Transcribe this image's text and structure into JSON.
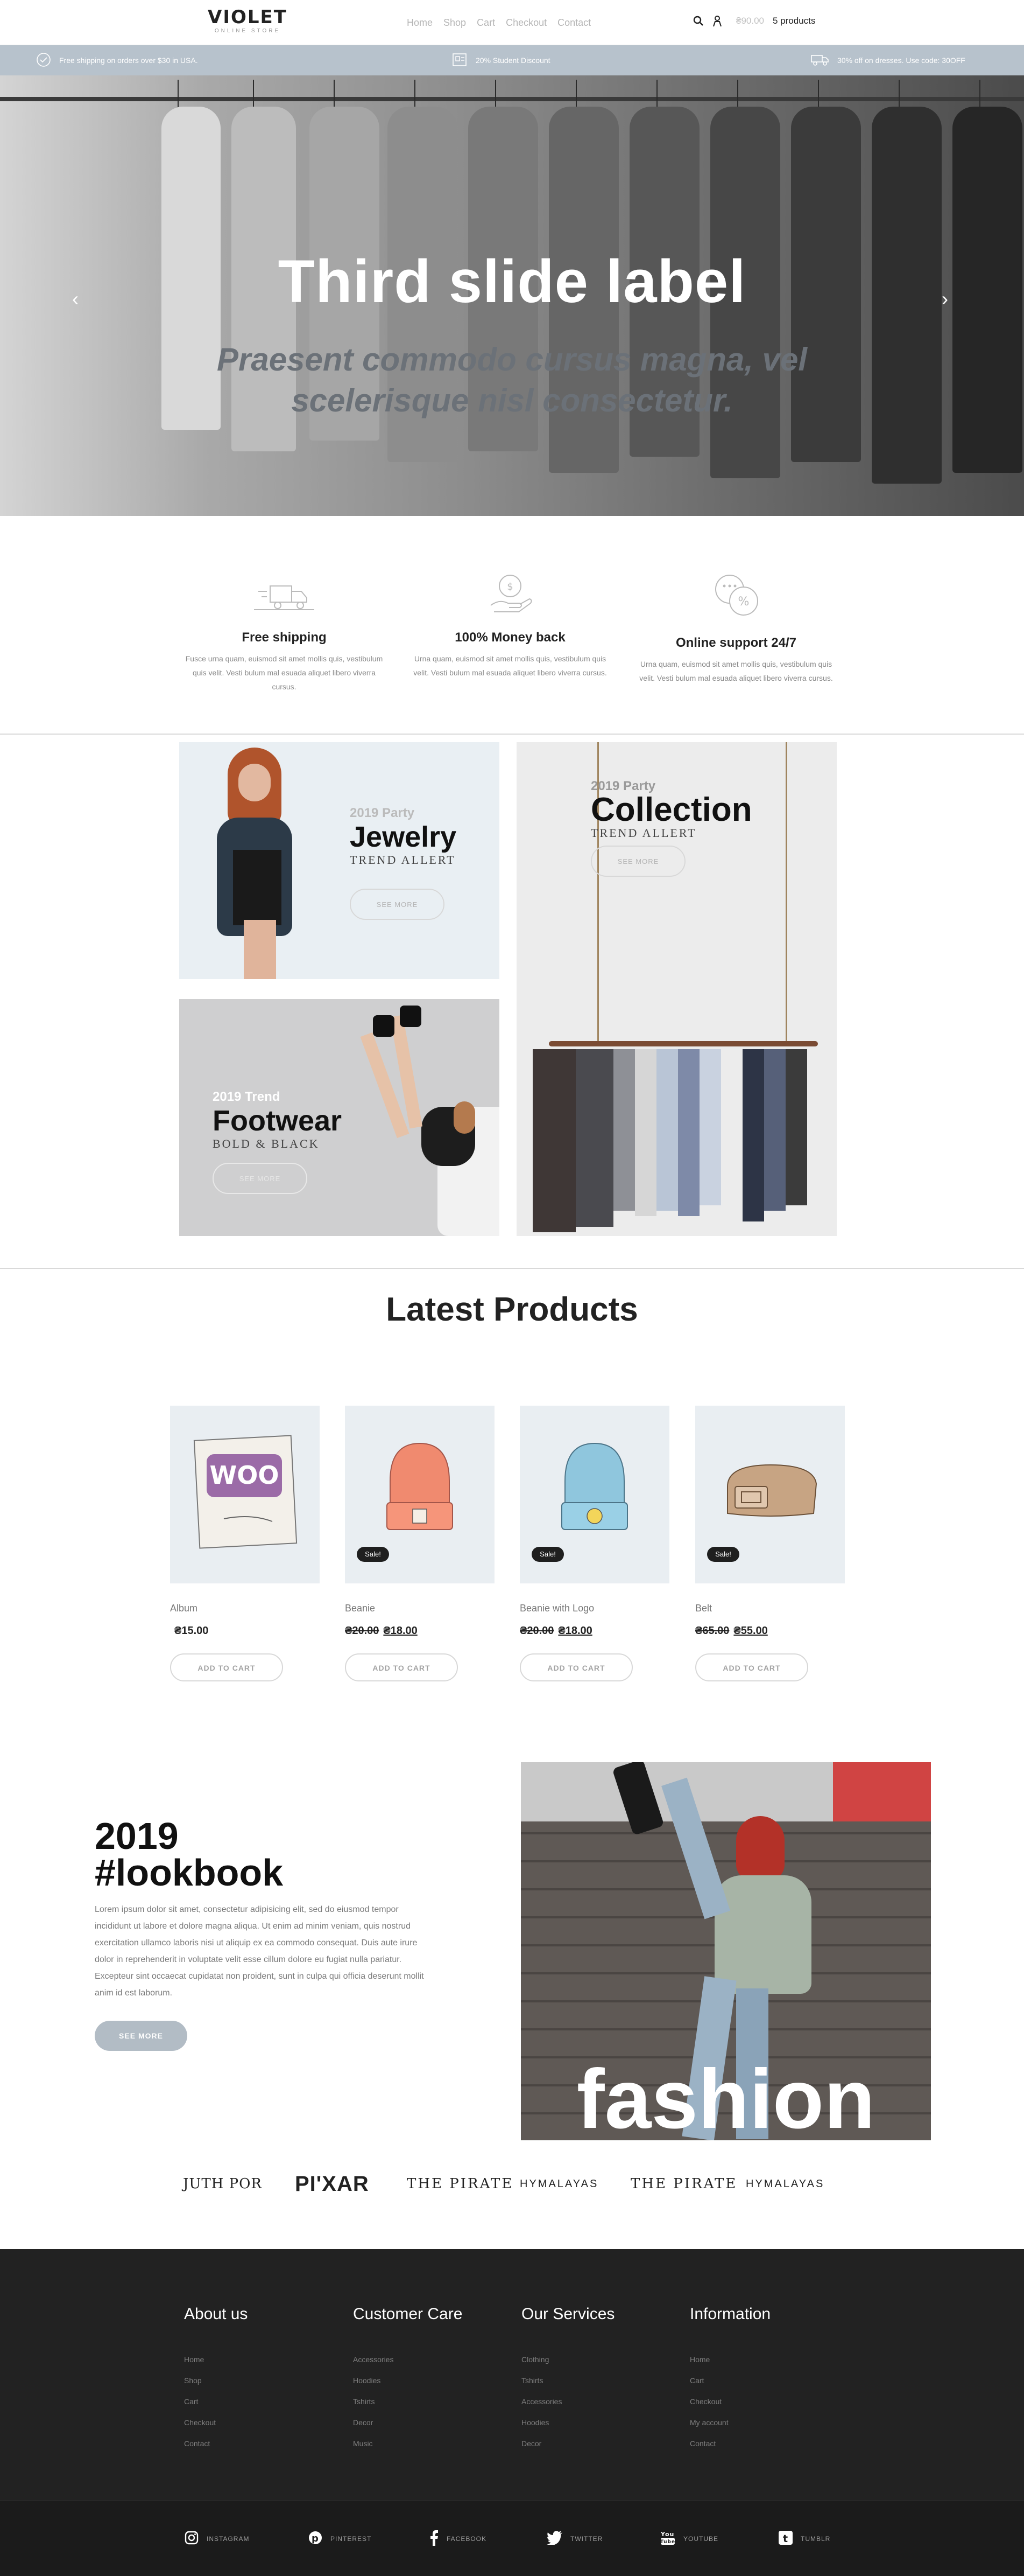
{
  "header": {
    "logo": "VIOLET",
    "logo_sub": "ONLINE STORE",
    "nav": [
      "Home",
      "Shop",
      "Cart",
      "Checkout",
      "Contact"
    ],
    "cart_total": "₴90.00",
    "cart_count": "5 products"
  },
  "promo": {
    "left": "Free shipping on orders over $30 in USA.",
    "center": "20% Student Discount",
    "right": "30% off on dresses. Use code: 30OFF"
  },
  "hero": {
    "title": "Third slide label",
    "subtitle": "Praesent commodo cursus magna, vel scelerisque nisl consectetur."
  },
  "features": [
    {
      "title": "Free shipping",
      "desc": "Fusce urna quam, euismod sit amet mollis quis, vestibulum quis velit. Vesti bulum mal esuada aliquet libero viverra cursus."
    },
    {
      "title": "100% Money back",
      "desc": "Urna quam, euismod sit amet mollis quis, vestibulum quis velit. Vesti bulum mal esuada aliquet libero viverra cursus."
    },
    {
      "title": "Online support 24/7",
      "desc": "Urna quam, euismod sit amet mollis quis, vestibulum quis velit. Vesti bulum mal esuada aliquet libero viverra cursus."
    }
  ],
  "banners": {
    "jewelry": {
      "small": "2019 Party",
      "big": "Jewelry",
      "sub": "TREND ALLERT",
      "button": "SEE MORE"
    },
    "footwear": {
      "small": "2019 Trend",
      "big": "Footwear",
      "sub": "BOLD & BLACK",
      "button": "SEE MORE"
    },
    "collection": {
      "small": "2019 Party",
      "big": "Collection",
      "sub": "TREND ALLERT",
      "button": "SEE MORE"
    }
  },
  "products": {
    "title": "Latest Products",
    "items": [
      {
        "name": "Album",
        "price": "₴15.00",
        "old_price": "",
        "sale": "",
        "button": "ADD TO CART",
        "art": "WOO"
      },
      {
        "name": "Beanie",
        "price": "₴18.00",
        "old_price": "₴20.00",
        "sale": "Sale!",
        "button": "ADD TO CART"
      },
      {
        "name": "Beanie with Logo",
        "price": "₴18.00",
        "old_price": "₴20.00",
        "sale": "Sale!",
        "button": "ADD TO CART"
      },
      {
        "name": "Belt",
        "price": "₴55.00",
        "old_price": "₴65.00",
        "sale": "Sale!",
        "button": "ADD TO CART"
      }
    ]
  },
  "lookbook": {
    "year": "2019",
    "tag": "#lookbook",
    "text": "Lorem ipsum dolor sit amet, consectetur adipisicing elit, sed do eiusmod tempor incididunt ut labore et dolore magna aliqua. Ut enim ad minim veniam, quis nostrud exercitation ullamco laboris nisi ut aliquip ex ea commodo consequat. Duis aute irure dolor in reprehenderit in voluptate velit esse cillum dolore eu fugiat nulla pariatur. Excepteur sint occaecat cupidatat non proident, sunt in culpa qui officia deserunt mollit anim id est laborum.",
    "button": "SEE MORE",
    "photo_word": "fashion"
  },
  "brands": [
    "JUTH POR",
    "PI'XAR",
    "THE PIRATE",
    "HYMALAYAS",
    "THE PIRATE",
    "HYMALAYAS"
  ],
  "footer": {
    "columns": [
      {
        "title": "About us",
        "links": [
          "Home",
          "Shop",
          "Cart",
          "Checkout",
          "Contact"
        ]
      },
      {
        "title": "Customer Care",
        "links": [
          "Accessories",
          "Hoodies",
          "Tshirts",
          "Decor",
          "Music"
        ]
      },
      {
        "title": "Our Services",
        "links": [
          "Clothing",
          "Tshirts",
          "Accessories",
          "Hoodies",
          "Decor"
        ]
      },
      {
        "title": "Information",
        "links": [
          "Home",
          "Cart",
          "Checkout",
          "My account",
          "Contact"
        ]
      }
    ],
    "social": [
      "INSTAGRAM",
      "PINTEREST",
      "FACEBOOK",
      "TWITTER",
      "YOUTUBE",
      "TUMBLR"
    ]
  }
}
